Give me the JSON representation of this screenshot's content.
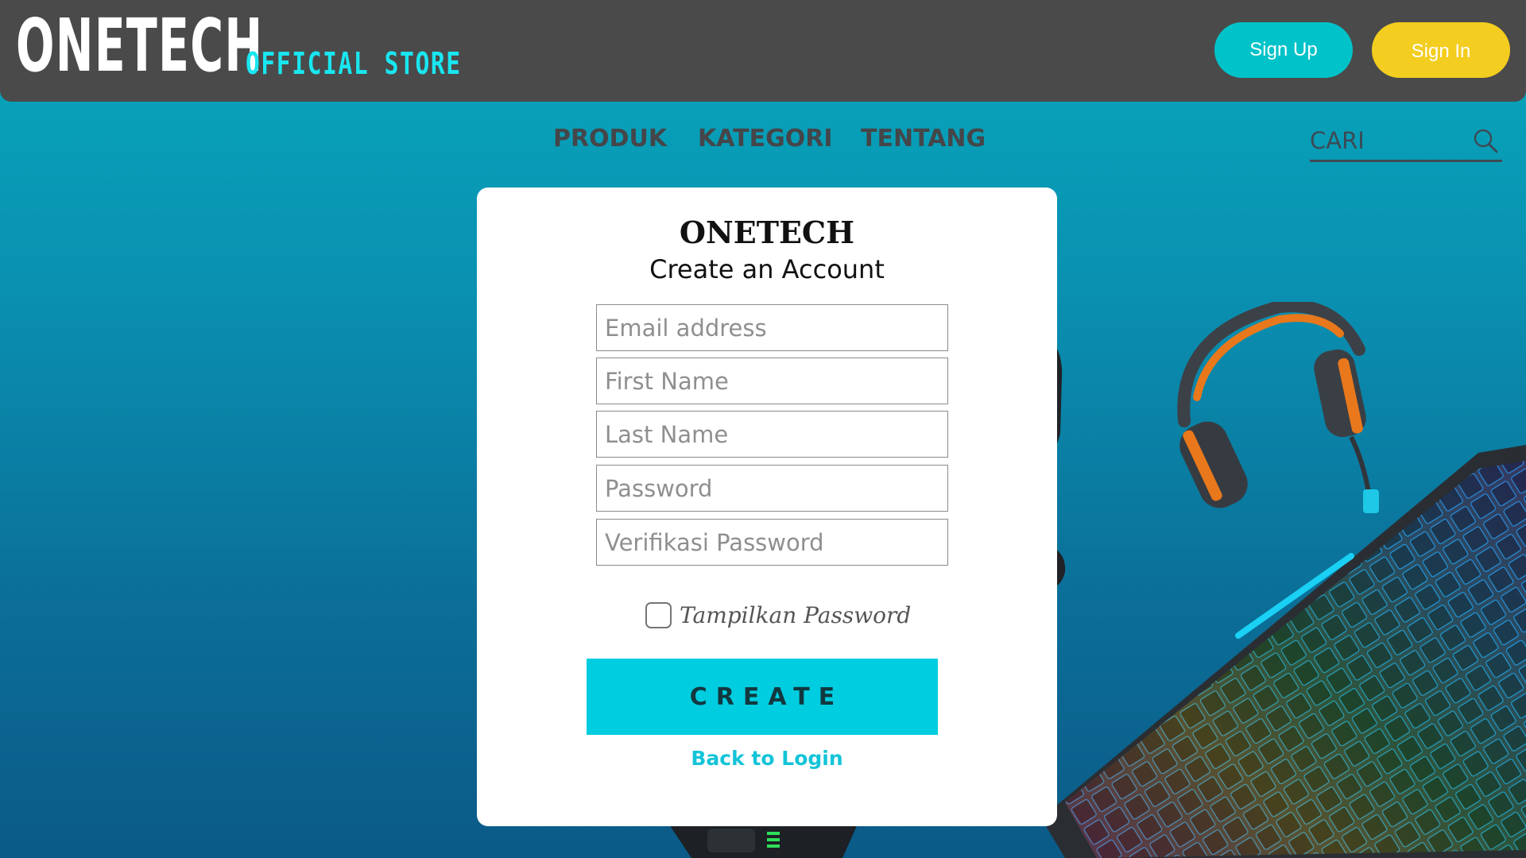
{
  "header": {
    "logo_main": "ONETECH",
    "logo_sub": "OFFICIAL STORE",
    "signup_label": "Sign Up",
    "signin_label": "Sign In"
  },
  "nav": {
    "items": [
      {
        "label": "PRODUK"
      },
      {
        "label": "KATEGORI"
      },
      {
        "label": "TENTANG"
      }
    ],
    "search_placeholder": "CARI",
    "search_icon": "search-icon"
  },
  "form": {
    "brand": "ONETECH",
    "title": "Create an Account",
    "fields": [
      {
        "placeholder": "Email address",
        "value": ""
      },
      {
        "placeholder": "First Name",
        "value": ""
      },
      {
        "placeholder": "Last Name",
        "value": ""
      },
      {
        "placeholder": "Password",
        "value": ""
      },
      {
        "placeholder": "Verifikasi Password",
        "value": ""
      }
    ],
    "show_password_label": "Tampilkan Password",
    "show_password_checked": false,
    "create_label": "CREATE",
    "back_label": "Back to Login"
  },
  "colors": {
    "topbar": "#4a4a4a",
    "signup": "#00c3c9",
    "signin": "#f3cd1f",
    "accent": "#00cde0",
    "logo_sub": "#19e6f0"
  }
}
